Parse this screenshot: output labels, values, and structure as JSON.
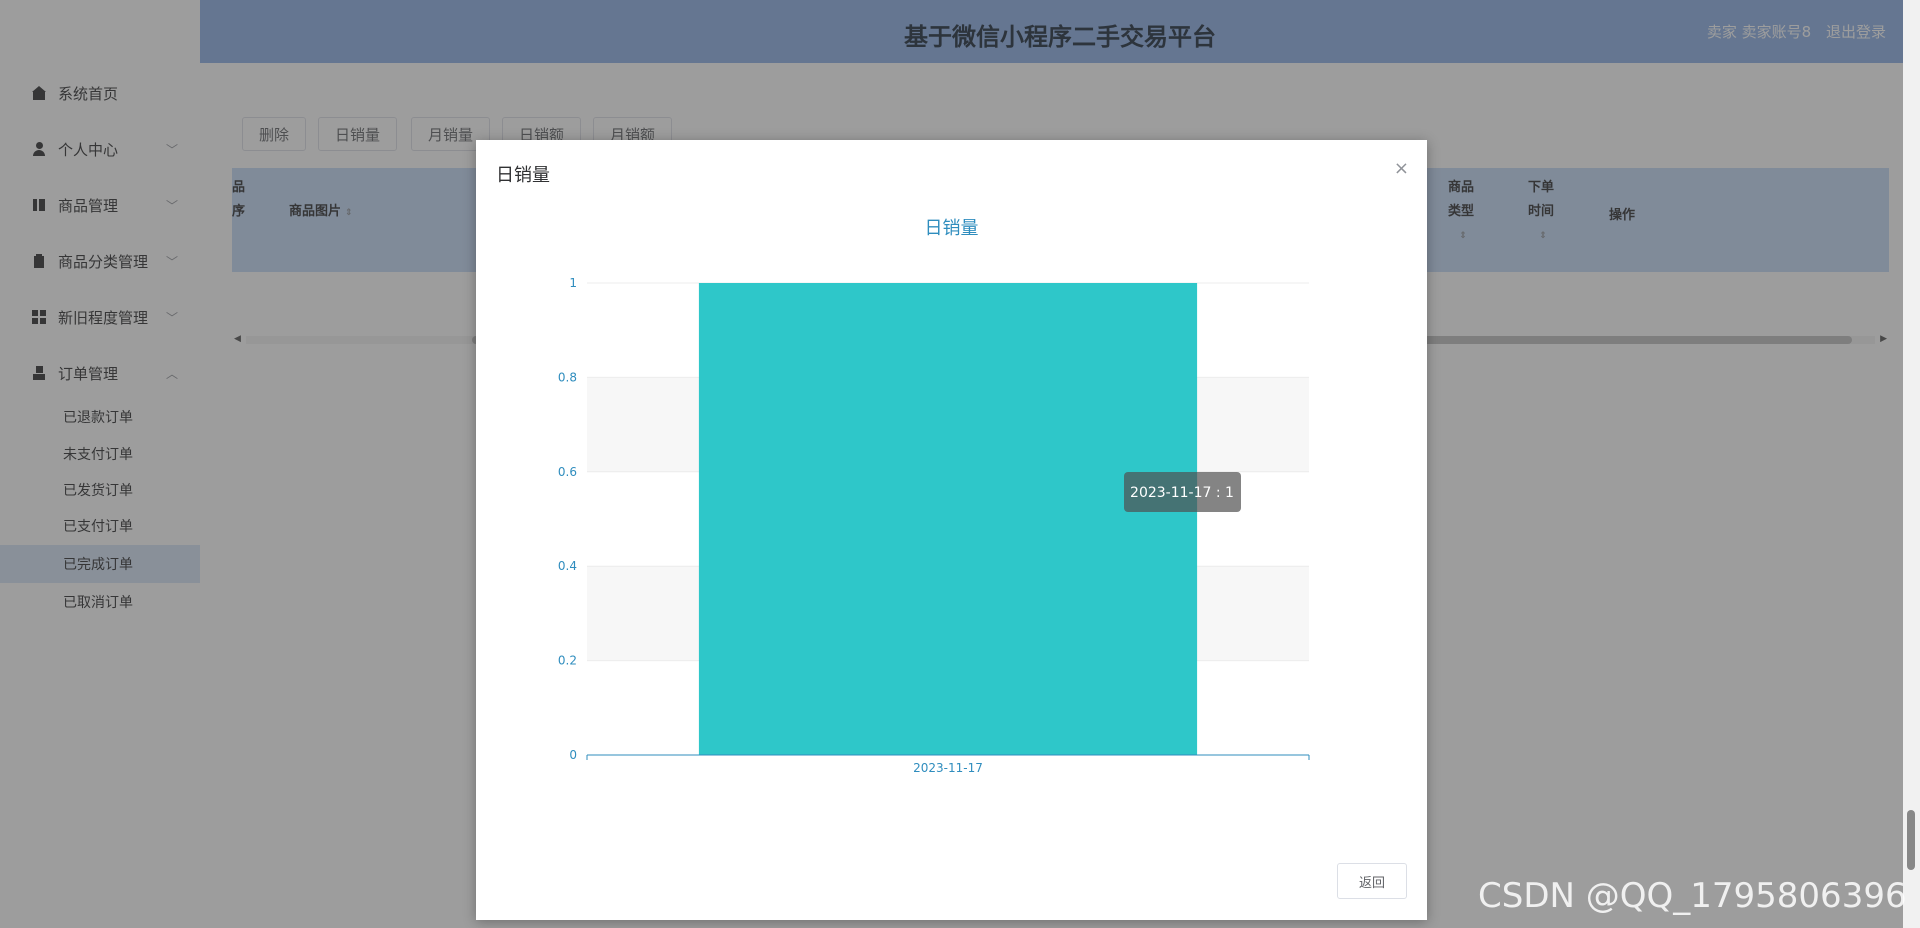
{
  "app": {
    "title": "基于微信小程序二手交易平台",
    "user_label": "卖家 卖家账号8",
    "logout_label": "退出登录"
  },
  "sidebar": {
    "items": [
      {
        "label": "系统首页",
        "icon": "home-icon"
      },
      {
        "label": "个人中心",
        "icon": "user-icon"
      },
      {
        "label": "商品管理",
        "icon": "box-icon"
      },
      {
        "label": "商品分类管理",
        "icon": "clipboard-icon"
      },
      {
        "label": "新旧程度管理",
        "icon": "grid-icon"
      },
      {
        "label": "订单管理",
        "icon": "person-icon"
      }
    ],
    "order_subitems": [
      {
        "label": "已退款订单"
      },
      {
        "label": "未支付订单"
      },
      {
        "label": "已发货订单"
      },
      {
        "label": "已支付订单"
      },
      {
        "label": "已完成订单"
      },
      {
        "label": "已取消订单"
      }
    ],
    "active_subitem": "已完成订单"
  },
  "toolbar": {
    "delete_label": "删除",
    "daily_sales_label": "日销量",
    "monthly_sales_label": "月销量",
    "daily_revenue_label": "日销额",
    "monthly_revenue_label": "月销额"
  },
  "table": {
    "headers": {
      "col0_top": "品",
      "col0_bottom": "序",
      "image": "商品图片",
      "type_top": "商品",
      "type_bottom": "类型",
      "time_top": "下单",
      "time_bottom": "时间",
      "actions": "操作"
    }
  },
  "dialog": {
    "title": "日销量",
    "close_glyph": "×",
    "return_label": "返回",
    "tooltip": "2023-11-17 : 1"
  },
  "chart_data": {
    "type": "bar",
    "title": "日销量",
    "categories": [
      "2023-11-17"
    ],
    "values": [
      1
    ],
    "ylim": [
      0,
      1
    ],
    "yticks": [
      "0",
      "0.2",
      "0.4",
      "0.6",
      "0.8",
      "1"
    ],
    "grid": true,
    "colors": {
      "bar": "#2ec7c9",
      "axis": "#2f8dbe",
      "grid_band": "#f7f7f7"
    }
  },
  "watermark": "CSDN @QQ_1795806396"
}
